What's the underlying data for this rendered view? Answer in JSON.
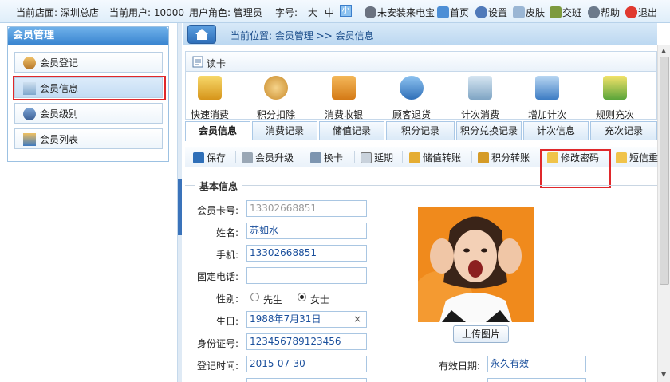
{
  "topbar": {
    "store_label": "当前店面: 深圳总店",
    "user_label": "当前用户: 10000",
    "role_label": "用户角色: 管理员",
    "font_label": "字号:",
    "size_large": "大",
    "size_medium": "中",
    "size_small": "小",
    "links": [
      {
        "label": "未安装来电宝",
        "icon": "phone-icon"
      },
      {
        "label": "首页",
        "icon": "home-icon"
      },
      {
        "label": "设置",
        "icon": "user-settings-icon"
      },
      {
        "label": "皮肤",
        "icon": "skin-icon"
      },
      {
        "label": "交班",
        "icon": "shift-icon"
      },
      {
        "label": "帮助",
        "icon": "help-icon"
      },
      {
        "label": "退出",
        "icon": "exit-icon"
      }
    ]
  },
  "sidebar": {
    "title": "会员管理",
    "items": [
      {
        "label": "会员登记",
        "icon": "member-register-icon"
      },
      {
        "label": "会员信息",
        "icon": "member-info-icon",
        "active": true
      },
      {
        "label": "会员级别",
        "icon": "member-level-icon"
      },
      {
        "label": "会员列表",
        "icon": "member-list-icon"
      }
    ]
  },
  "breadcrumb": {
    "text": "当前位置: 会员管理  >> 会员信息"
  },
  "readcard": {
    "label": "读卡"
  },
  "toolbar": [
    {
      "label": "快速消费",
      "icon": "quick-consume-icon",
      "color": "#e8b62a"
    },
    {
      "label": "积分扣除",
      "icon": "points-deduct-icon",
      "color": "#e0a640"
    },
    {
      "label": "消费收银",
      "icon": "cashier-basket-icon",
      "color": "#e89a2c"
    },
    {
      "label": "顾客退货",
      "icon": "customer-return-icon",
      "color": "#3a88cf"
    },
    {
      "label": "计次消费",
      "icon": "count-consume-icon",
      "color": "#6aa0c8"
    },
    {
      "label": "增加计次",
      "icon": "add-count-icon",
      "color": "#4f8fd0"
    },
    {
      "label": "规则充次",
      "icon": "rule-recharge-icon",
      "color": "#6ab548"
    }
  ],
  "tabs": [
    "会员信息",
    "消费记录",
    "储值记录",
    "积分记录",
    "积分兑换记录",
    "计次信息",
    "充次记录"
  ],
  "actions": [
    {
      "label": "保存",
      "icon": "save-icon"
    },
    {
      "label": "会员升级",
      "icon": "upgrade-icon"
    },
    {
      "label": "换卡",
      "icon": "card-icon"
    },
    {
      "label": "延期",
      "icon": "calendar-icon"
    },
    {
      "label": "储值转账",
      "icon": "stored-transfer-icon"
    },
    {
      "label": "积分转账",
      "icon": "points-transfer-icon"
    },
    {
      "label": "修改密码",
      "icon": "edit-password-icon"
    },
    {
      "label": "短信重",
      "icon": "sms-icon"
    }
  ],
  "form": {
    "legend": "基本信息",
    "card_no_label": "会员卡号:",
    "card_no": "13302668851",
    "name_label": "姓名:",
    "name": "苏如水",
    "mobile_label": "手机:",
    "mobile": "13302668851",
    "phone_label": "固定电话:",
    "phone": "",
    "gender_label": "性别:",
    "gender_male": "先生",
    "gender_female": "女士",
    "gender_selected": "女士",
    "birthday_label": "生日:",
    "birthday": "1988年7月31日",
    "id_label": "身份证号:",
    "id_no": "123456789123456",
    "register_label": "登记时间:",
    "register_date": "2015-07-30",
    "expire_label": "有效日期:",
    "expire": "永久有效",
    "upload_label": "上传图片"
  },
  "colors": {
    "accent": "#3a85d0",
    "highlight": "#e0282b",
    "value_text": "#1a4f9c"
  }
}
